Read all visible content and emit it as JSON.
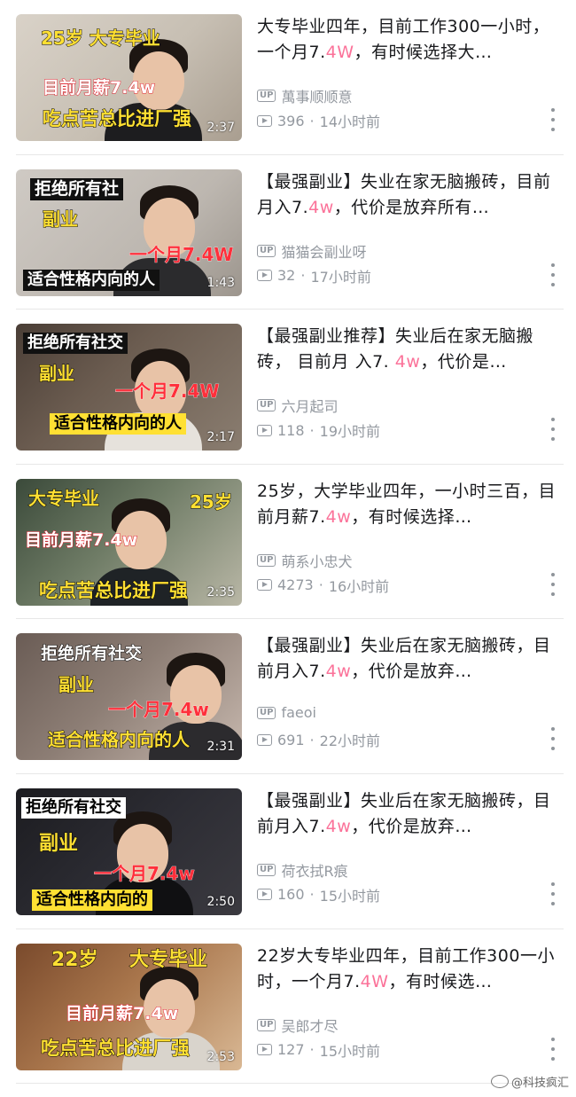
{
  "videos": [
    {
      "title_pre": "大专毕业四年，目前工作300一小时，一个月7.",
      "title_hl": "4W",
      "title_post": "，有时候选择大…",
      "uploader": "萬事顺顺意",
      "views": "396",
      "time": "14小时前",
      "duration": "2:37",
      "overlay": [
        "25岁 大专毕业",
        "目前月薪7.4w",
        "吃点苦总比进厂强"
      ]
    },
    {
      "title_pre": "【最强副业】失业在家无脑搬砖，目前月入7.",
      "title_hl": "4w",
      "title_post": "，代价是放弃所有…",
      "uploader": "猫猫会副业呀",
      "views": "32",
      "time": "17小时前",
      "duration": "1:43",
      "overlay": [
        "拒绝所有社",
        "副业",
        "一个月7.4W",
        "适合性格内向的人"
      ]
    },
    {
      "title_pre": "【最强副业推荐】失业后在家无脑搬砖， 目前月 入7. ",
      "title_hl": "4w",
      "title_post": "，代价是…",
      "uploader": "六月起司",
      "views": "118",
      "time": "19小时前",
      "duration": "2:17",
      "overlay": [
        "拒绝所有社交",
        "副业",
        "一个月7.4W",
        "适合性格内向的人"
      ]
    },
    {
      "title_pre": "25岁，大学毕业四年，一小时三百，目前月薪7.",
      "title_hl": "4w",
      "title_post": "，有时候选择…",
      "uploader": "萌系小忠犬",
      "views": "4273",
      "time": "16小时前",
      "duration": "2:35",
      "overlay": [
        "大专毕业",
        "25岁",
        "目前月薪7.4w",
        "吃点苦总比进厂强"
      ]
    },
    {
      "title_pre": "【最强副业】失业后在家无脑搬砖，目前月入7.",
      "title_hl": "4w",
      "title_post": "，代价是放弃…",
      "uploader": "faeoi",
      "views": "691",
      "time": "22小时前",
      "duration": "2:31",
      "overlay": [
        "拒绝所有社交",
        "副业",
        "一个月7.4w",
        "适合性格内向的人"
      ]
    },
    {
      "title_pre": "【最强副业】失业后在家无脑搬砖，目前月入7.",
      "title_hl": "4w",
      "title_post": "，代价是放弃…",
      "uploader": "荷衣拭R痕",
      "views": "160",
      "time": "15小时前",
      "duration": "2:50",
      "overlay": [
        "拒绝所有社交",
        "副业",
        "一个月7.4w",
        "适合性格内向的"
      ]
    },
    {
      "title_pre": "22岁大专毕业四年，目前工作300一小时，一个月7.",
      "title_hl": "4W",
      "title_post": "，有时候选…",
      "uploader": "吴郎才尽",
      "views": "127",
      "time": "15小时前",
      "duration": "2:53",
      "overlay": [
        "22岁",
        "大专毕业",
        "目前月薪7.4w",
        "吃点苦总比进厂强"
      ]
    }
  ],
  "labels": {
    "up_badge": "UP",
    "separator": "·"
  },
  "watermark": "@科技疯汇",
  "colors": {
    "highlight": "#fb7299",
    "meta_gray": "#9499a0"
  }
}
